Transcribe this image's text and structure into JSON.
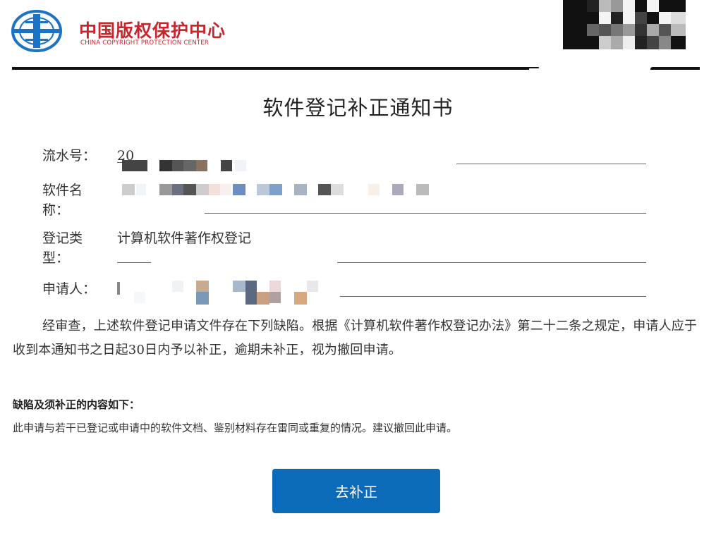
{
  "header": {
    "org_name_cn": "中国版权保护中心",
    "org_name_en": "CHINA COPYRIGHT PROTECTION CENTER",
    "brand_color": "#c8252c"
  },
  "document": {
    "title": "软件登记补正通知书",
    "fields": [
      {
        "label": "流水号：",
        "value": "20"
      },
      {
        "label": "软件名称：",
        "value": ""
      },
      {
        "label": "登记类型：",
        "value": "计算机软件著作权登记"
      },
      {
        "label": "申请人：",
        "value": ""
      }
    ],
    "notice": "经审查，上述软件登记申请文件存在下列缺陷。根据《计算机软件著作权登记办法》第二十二条之规定，申请人应于收到本通知书之日起30日内予以补正，逾期未补正，视为撤回申请。",
    "defects_heading": "缺陷及须补正的内容如下：",
    "defects_body": "此申请与若干已登记或申请中的软件文档、鉴别材料存在雷同或重复的情况。建议撤回此申请。"
  },
  "actions": {
    "correct_button": "去补正",
    "button_color": "#0c6bb9"
  }
}
